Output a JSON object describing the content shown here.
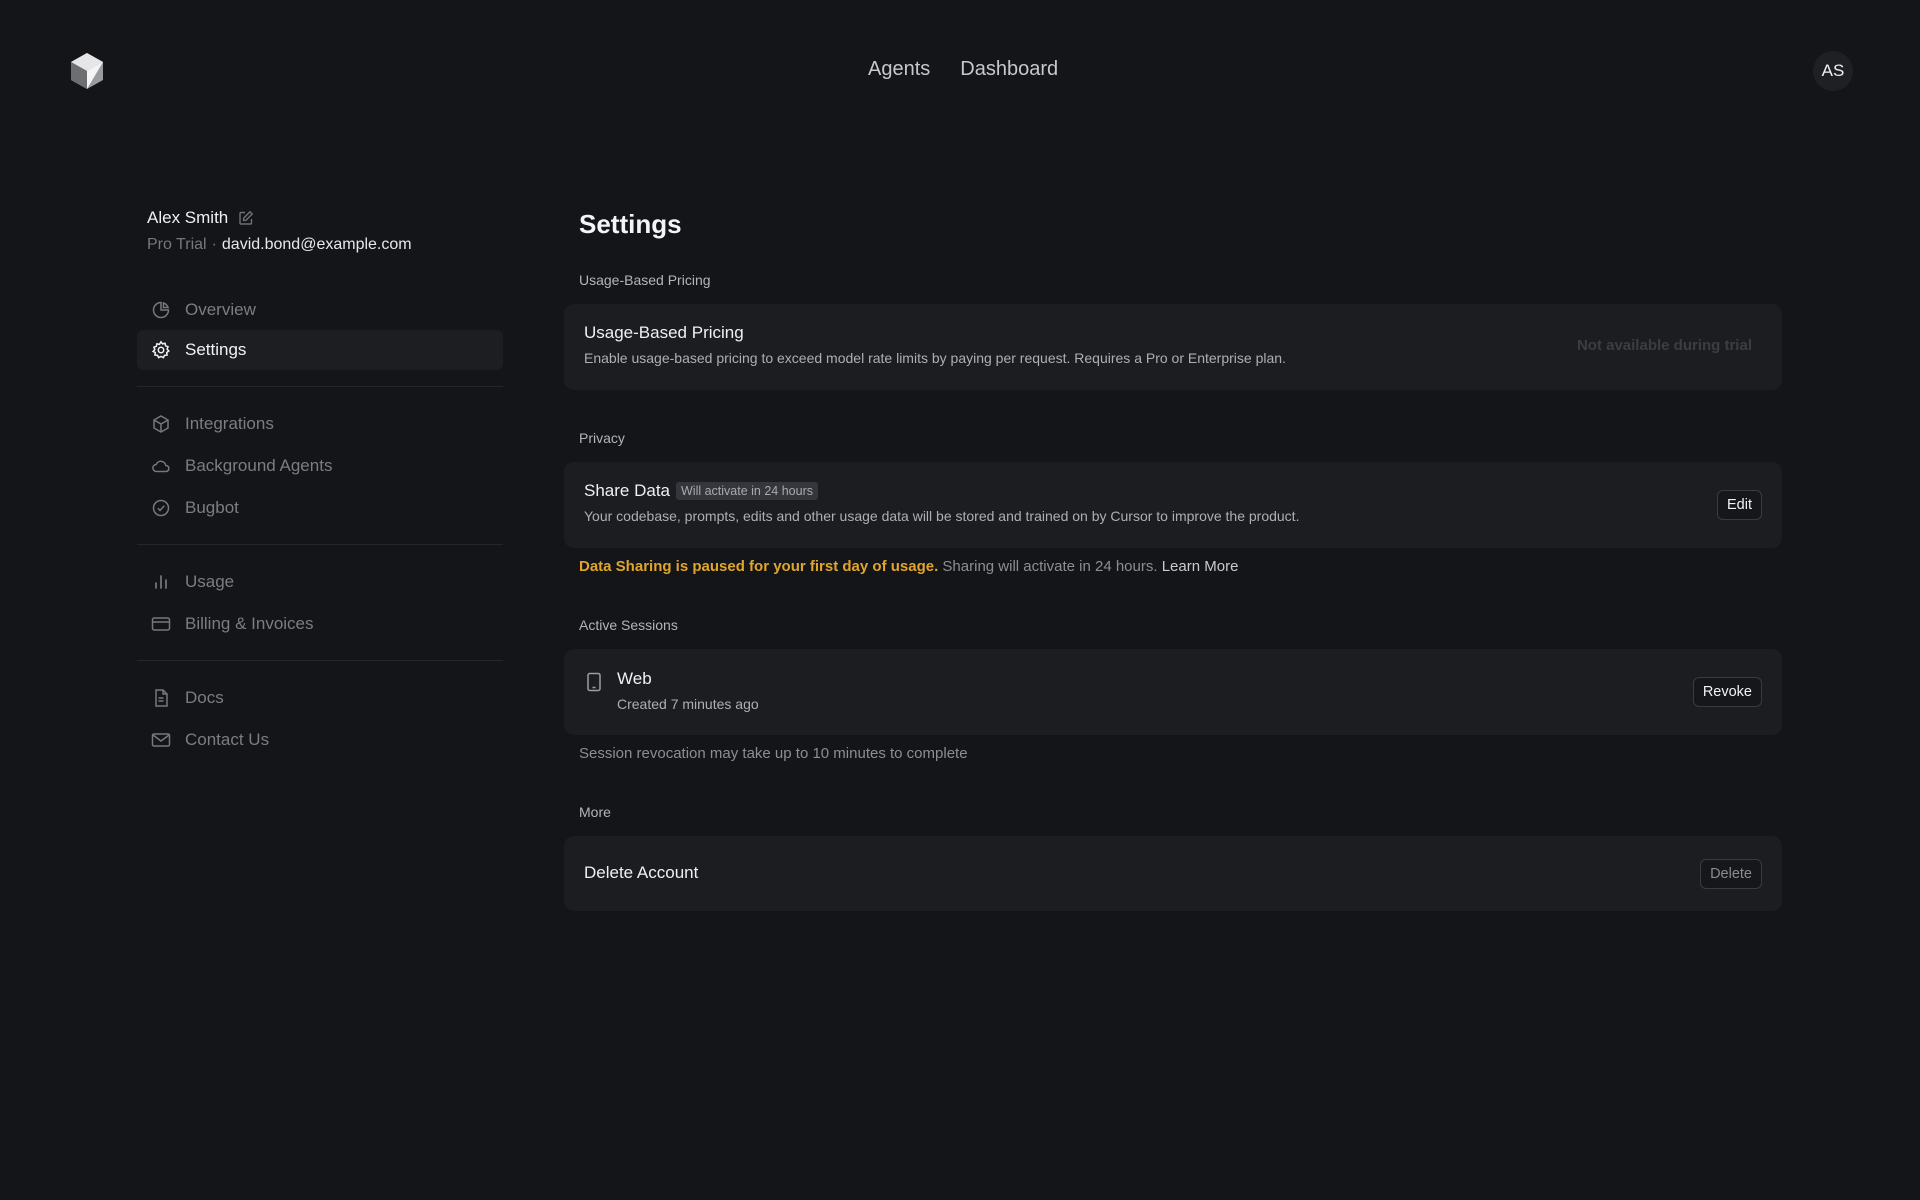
{
  "header": {
    "nav": [
      "Agents",
      "Dashboard"
    ],
    "avatar_initials": "AS"
  },
  "user": {
    "name": "Alex Smith",
    "plan": "Pro Trial",
    "separator": "·",
    "email": "david.bond@example.com"
  },
  "sidebar": {
    "items": [
      {
        "label": "Overview",
        "icon": "pie-chart-icon",
        "active": false
      },
      {
        "label": "Settings",
        "icon": "gear-icon",
        "active": true
      },
      {
        "label": "Integrations",
        "icon": "cube-icon",
        "active": false
      },
      {
        "label": "Background Agents",
        "icon": "cloud-icon",
        "active": false
      },
      {
        "label": "Bugbot",
        "icon": "check-circle-icon",
        "active": false
      },
      {
        "label": "Usage",
        "icon": "bar-chart-icon",
        "active": false
      },
      {
        "label": "Billing & Invoices",
        "icon": "credit-card-icon",
        "active": false
      },
      {
        "label": "Docs",
        "icon": "document-icon",
        "active": false
      },
      {
        "label": "Contact Us",
        "icon": "mail-icon",
        "active": false
      }
    ]
  },
  "main": {
    "title": "Settings",
    "usage_pricing": {
      "section_label": "Usage-Based Pricing",
      "title": "Usage-Based Pricing",
      "description": "Enable usage-based pricing to exceed model rate limits by paying per request. Requires a Pro or Enterprise plan.",
      "status": "Not available during trial"
    },
    "privacy": {
      "section_label": "Privacy",
      "title": "Share Data",
      "badge": "Will activate in 24 hours",
      "description": "Your codebase, prompts, edits and other usage data will be stored and trained on by Cursor to improve the product.",
      "button": "Edit",
      "note_warning": "Data Sharing is paused for your first day of usage.",
      "note_text": "Sharing will activate in 24 hours.",
      "note_link": "Learn More"
    },
    "sessions": {
      "section_label": "Active Sessions",
      "title": "Web",
      "created": "Created 7 minutes ago",
      "button": "Revoke",
      "note": "Session revocation may take up to 10 minutes to complete"
    },
    "more": {
      "section_label": "More",
      "title": "Delete Account",
      "button": "Delete"
    }
  },
  "colors": {
    "background": "#141518",
    "card": "#1c1d21",
    "warning": "#e0a52a"
  }
}
